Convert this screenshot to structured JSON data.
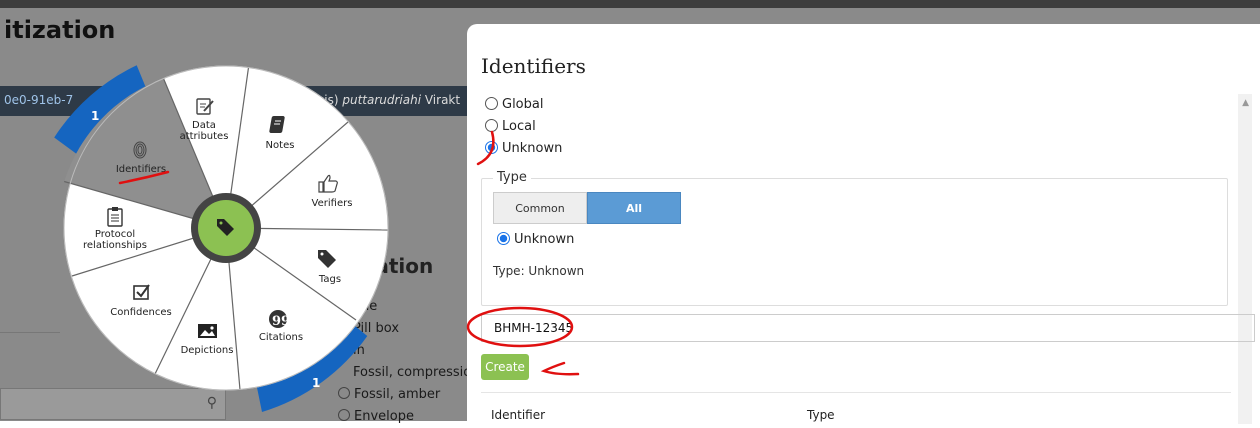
{
  "background": {
    "title": "itization",
    "record_id": "0e0-91eb-7",
    "species_prefix": "sis) ",
    "species_name": "puttarudriahi",
    "species_author": " Virakt",
    "section_heading": "aration",
    "options": [
      "one",
      "Pill box",
      "in",
      "Fossil, compressio",
      "Fossil, amber",
      "Envelope"
    ],
    "search_icon": "search-icon"
  },
  "wheel": {
    "center_icon": "tag-icon",
    "counters": [
      "1",
      "1"
    ],
    "slices": [
      {
        "label": "Data attributes",
        "icon": "edit-icon"
      },
      {
        "label": "Notes",
        "icon": "notebook-icon"
      },
      {
        "label": "Verifiers",
        "icon": "thumbs-up-icon"
      },
      {
        "label": "Tags",
        "icon": "tag-icon"
      },
      {
        "label": "Citations",
        "icon": "quote-icon"
      },
      {
        "label": "Depictions",
        "icon": "image-icon"
      },
      {
        "label": "Confidences",
        "icon": "checkbox-icon"
      },
      {
        "label": "Protocol relationships",
        "icon": "clipboard-icon"
      },
      {
        "label": "Identifiers",
        "icon": "fingerprint-icon"
      }
    ],
    "active": "Identifiers",
    "colors": {
      "wheel": "#ffffff",
      "active": "#8f8f8f",
      "center": "#8cc152",
      "counter": "#1565c0"
    }
  },
  "panel": {
    "title": "Identifiers",
    "scope_options": [
      {
        "label": "Global",
        "checked": false
      },
      {
        "label": "Local",
        "checked": false
      },
      {
        "label": "Unknown",
        "checked": true
      }
    ],
    "type_legend": "Type",
    "type_tabs": [
      "Common",
      "All"
    ],
    "type_option": "Unknown",
    "type_display": "Type: Unknown",
    "identifier_value": "BHMH-12345",
    "create_label": "Create",
    "table_headers": [
      "Identifier",
      "Type"
    ]
  }
}
